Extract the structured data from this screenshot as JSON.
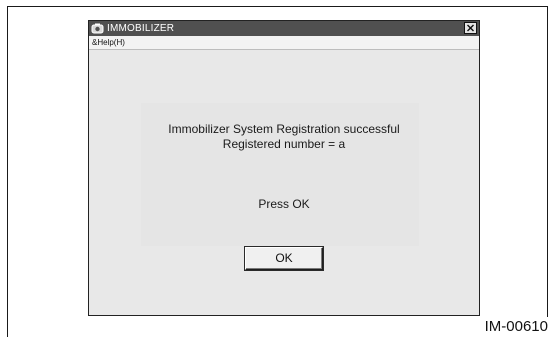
{
  "window": {
    "title": "IMMOBILIZER",
    "menu": {
      "help_label": "&Help(H)"
    }
  },
  "dialog": {
    "message_line_1": "Immobilizer System Registration successful",
    "message_line_2": "Registered number = a",
    "prompt": "Press OK",
    "ok_button_label": "OK"
  },
  "figure_label": "IM-00610",
  "icons": {
    "app": "app-icon",
    "close": "close-icon"
  },
  "colors": {
    "titlebar": "#505050",
    "window_background": "#ececec",
    "text": "#1a1a1a"
  }
}
